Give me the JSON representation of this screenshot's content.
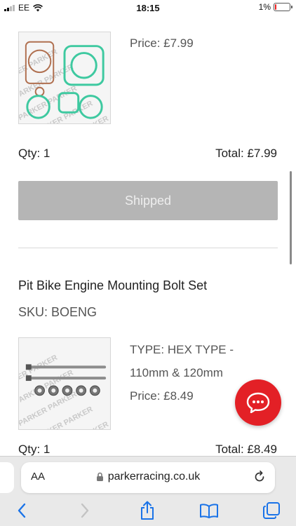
{
  "status_bar": {
    "carrier": "EE",
    "time": "18:15",
    "battery_percent": "1%",
    "battery_level": 0.01
  },
  "item1": {
    "price": "Price: £7.99",
    "qty": "Qty: 1",
    "total": "Total: £7.99",
    "status_button": "Shipped"
  },
  "item2": {
    "name": "Pit Bike Engine Mounting Bolt Set",
    "sku": "SKU: BOENG",
    "type_line1": "TYPE: HEX TYPE -",
    "type_line2": "110mm & 120mm",
    "price": "Price: £8.49",
    "qty": "Qty: 1",
    "total": "Total: £8.49"
  },
  "browser": {
    "aa_label": "AA",
    "url": "parkerracing.co.uk"
  },
  "colors": {
    "accent_chat": "#e32026",
    "ios_blue": "#1a73e8",
    "shipped_bg": "#b5b5b5"
  },
  "icons": [
    "wifi-icon",
    "chat-icon",
    "lock-icon",
    "reload-icon",
    "back-icon",
    "forward-icon",
    "share-icon",
    "bookmarks-icon",
    "tabs-icon"
  ]
}
